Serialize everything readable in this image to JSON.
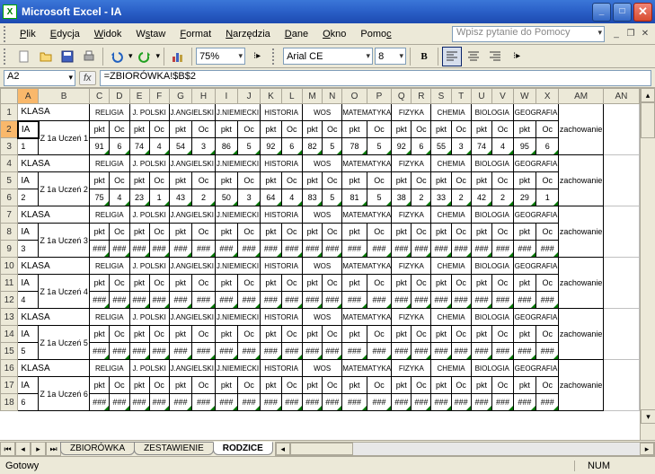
{
  "window": {
    "title": "Microsoft Excel - IA"
  },
  "menu": {
    "file": "Plik",
    "edit": "Edycja",
    "view": "Widok",
    "insert": "Wstaw",
    "format": "Format",
    "tools": "Narzędzia",
    "data": "Dane",
    "window": "Okno",
    "help": "Pomoc",
    "help_placeholder": "Wpisz pytanie do Pomocy"
  },
  "toolbar": {
    "zoom": "75%",
    "font": "Arial CE",
    "size": "8"
  },
  "formula": {
    "namebox": "A2",
    "value": "=ZBIORÓWKA!$B$2"
  },
  "columns": [
    "A",
    "B",
    "C",
    "D",
    "E",
    "F",
    "G",
    "H",
    "I",
    "J",
    "K",
    "L",
    "M",
    "N",
    "O",
    "P",
    "Q",
    "R",
    "S",
    "T",
    "U",
    "V",
    "W",
    "X",
    "AM",
    "AN"
  ],
  "row_nums": [
    "1",
    "2",
    "3",
    "4",
    "5",
    "6",
    "7",
    "8",
    "9",
    "10",
    "11",
    "12",
    "13",
    "14",
    "15",
    "16",
    "17",
    "18"
  ],
  "labels": {
    "klasa": "KLASA",
    "ia": "IA",
    "pkt": "pkt",
    "oc": "Oc",
    "hash": "###",
    "zachowanie": "zachowanie"
  },
  "subjects": [
    "RELIGIA",
    "J. POLSKI",
    "J.ANGIELSKI",
    "J.NIEMIECKI",
    "HISTORIA",
    "WOS",
    "MATEMATYKA",
    "FIZYKA",
    "CHEMIA",
    "BIOLOGIA",
    "GEOGRAFIA"
  ],
  "students": [
    "Z 1a Uczeń 1",
    "Z 1a Uczeń 2",
    "Z 1a Uczeń 3",
    "Z 1a Uczeń 4",
    "Z 1a Uczeń 5",
    "Z 1a Uczeń 6"
  ],
  "student_rows": [
    "1",
    "2",
    "3",
    "4",
    "5",
    "6"
  ],
  "data_rows": [
    [
      "91",
      "6",
      "74",
      "4",
      "54",
      "3",
      "86",
      "5",
      "92",
      "6",
      "82",
      "5",
      "78",
      "5",
      "92",
      "6",
      "55",
      "3",
      "74",
      "4",
      "95",
      "6"
    ],
    [
      "75",
      "4",
      "23",
      "1",
      "43",
      "2",
      "50",
      "3",
      "64",
      "4",
      "83",
      "5",
      "81",
      "5",
      "38",
      "2",
      "33",
      "2",
      "42",
      "2",
      "29",
      "1"
    ]
  ],
  "tabs": [
    "ZBIORÓWKA",
    "ZESTAWIENIE",
    "RODZICE"
  ],
  "status": {
    "ready": "Gotowy",
    "num": "NUM"
  }
}
